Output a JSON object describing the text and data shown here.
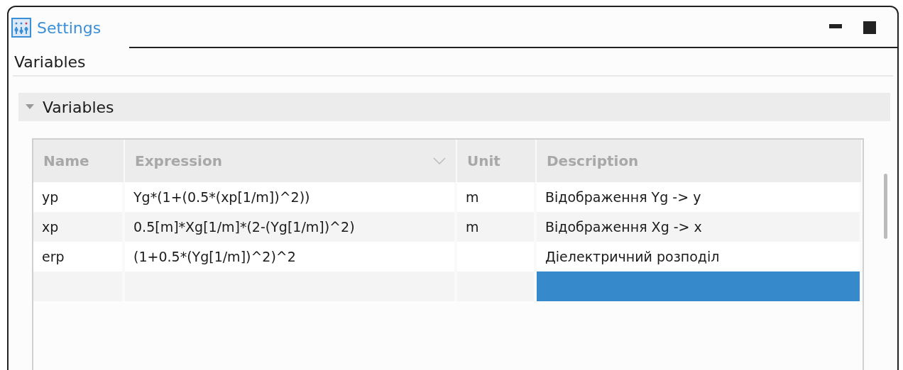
{
  "tab": {
    "title": "Settings",
    "selected": true
  },
  "page_title": "Variables",
  "section": {
    "title": "Variables",
    "expanded": true
  },
  "table": {
    "columns": [
      "Name",
      "Expression",
      "Unit",
      "Description"
    ],
    "rows": [
      {
        "name": "yp",
        "expression": "Yg*(1+(0.5*(xp[1/m])^2))",
        "unit": "m",
        "description": "Відображення Yg -> y",
        "selected": false
      },
      {
        "name": "xp",
        "expression": "0.5[m]*Xg[1/m]*(2-(Yg[1/m])^2)",
        "unit": "m",
        "description": "Відображення Xg -> x",
        "selected": false
      },
      {
        "name": "erp",
        "expression": "(1+0.5*(Yg[1/m])^2)^2",
        "description": "Діелектричний розподіл",
        "selected": false
      },
      {
        "selected": true
      }
    ]
  }
}
